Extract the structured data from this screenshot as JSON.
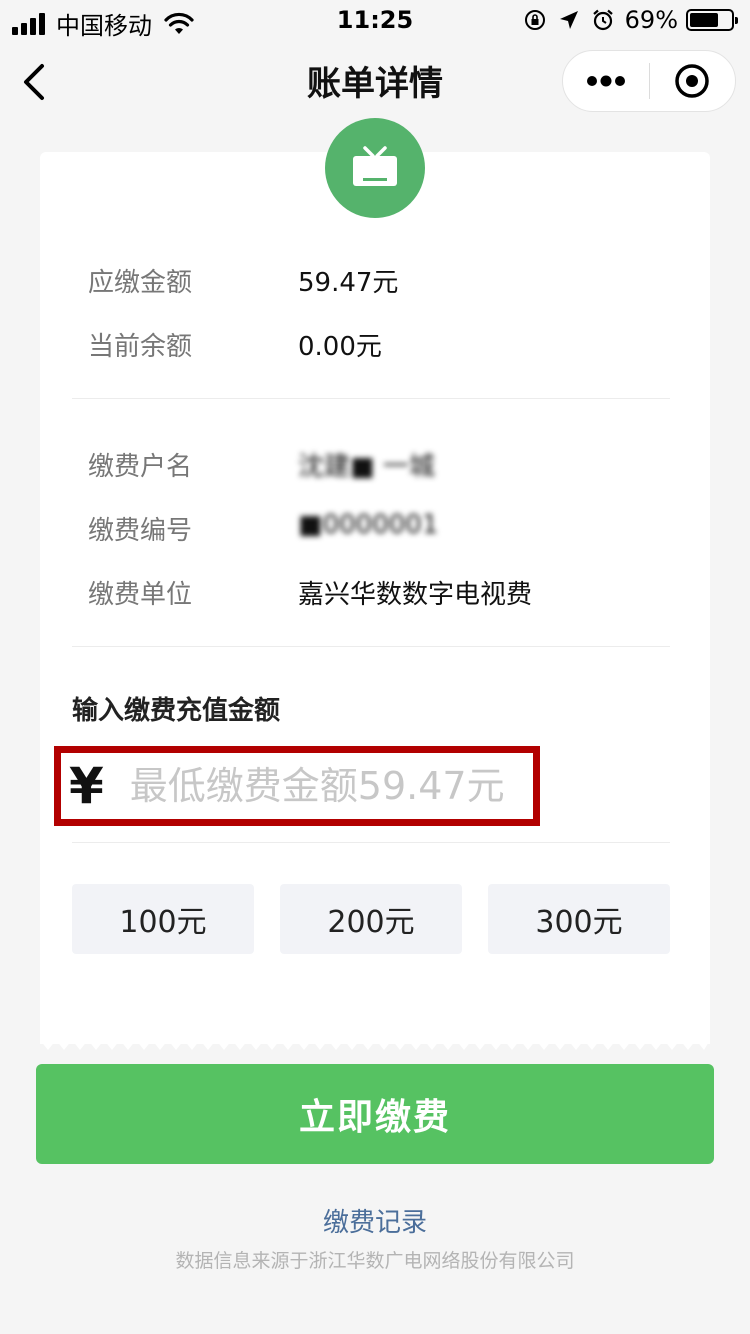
{
  "status_bar": {
    "carrier": "中国移动",
    "time": "11:25",
    "battery_percent": "69%",
    "battery_level": 0.69
  },
  "nav": {
    "title": "账单详情"
  },
  "bill": {
    "due_label": "应缴金额",
    "due_value": "59.47元",
    "balance_label": "当前余额",
    "balance_value": "0.00元",
    "account_name_label": "缴费户名",
    "account_name_value": "沈建■ 一城",
    "account_no_label": "缴费编号",
    "account_no_value": "■0000001",
    "unit_label": "缴费单位",
    "unit_value": "嘉兴华数数字电视费"
  },
  "recharge": {
    "title": "输入缴费充值金额",
    "currency_symbol": "¥",
    "placeholder": "最低缴费金额59.47元",
    "quick_amounts": [
      "100元",
      "200元",
      "300元"
    ]
  },
  "actions": {
    "pay_label": "立即缴费",
    "records_label": "缴费记录"
  },
  "footer": {
    "note": "数据信息来源于浙江华数广电网络股份有限公司"
  },
  "colors": {
    "accent_green": "#56c262",
    "badge_green": "#55b36c",
    "highlight_red": "#b20000",
    "link_blue": "#4b6e9a"
  }
}
